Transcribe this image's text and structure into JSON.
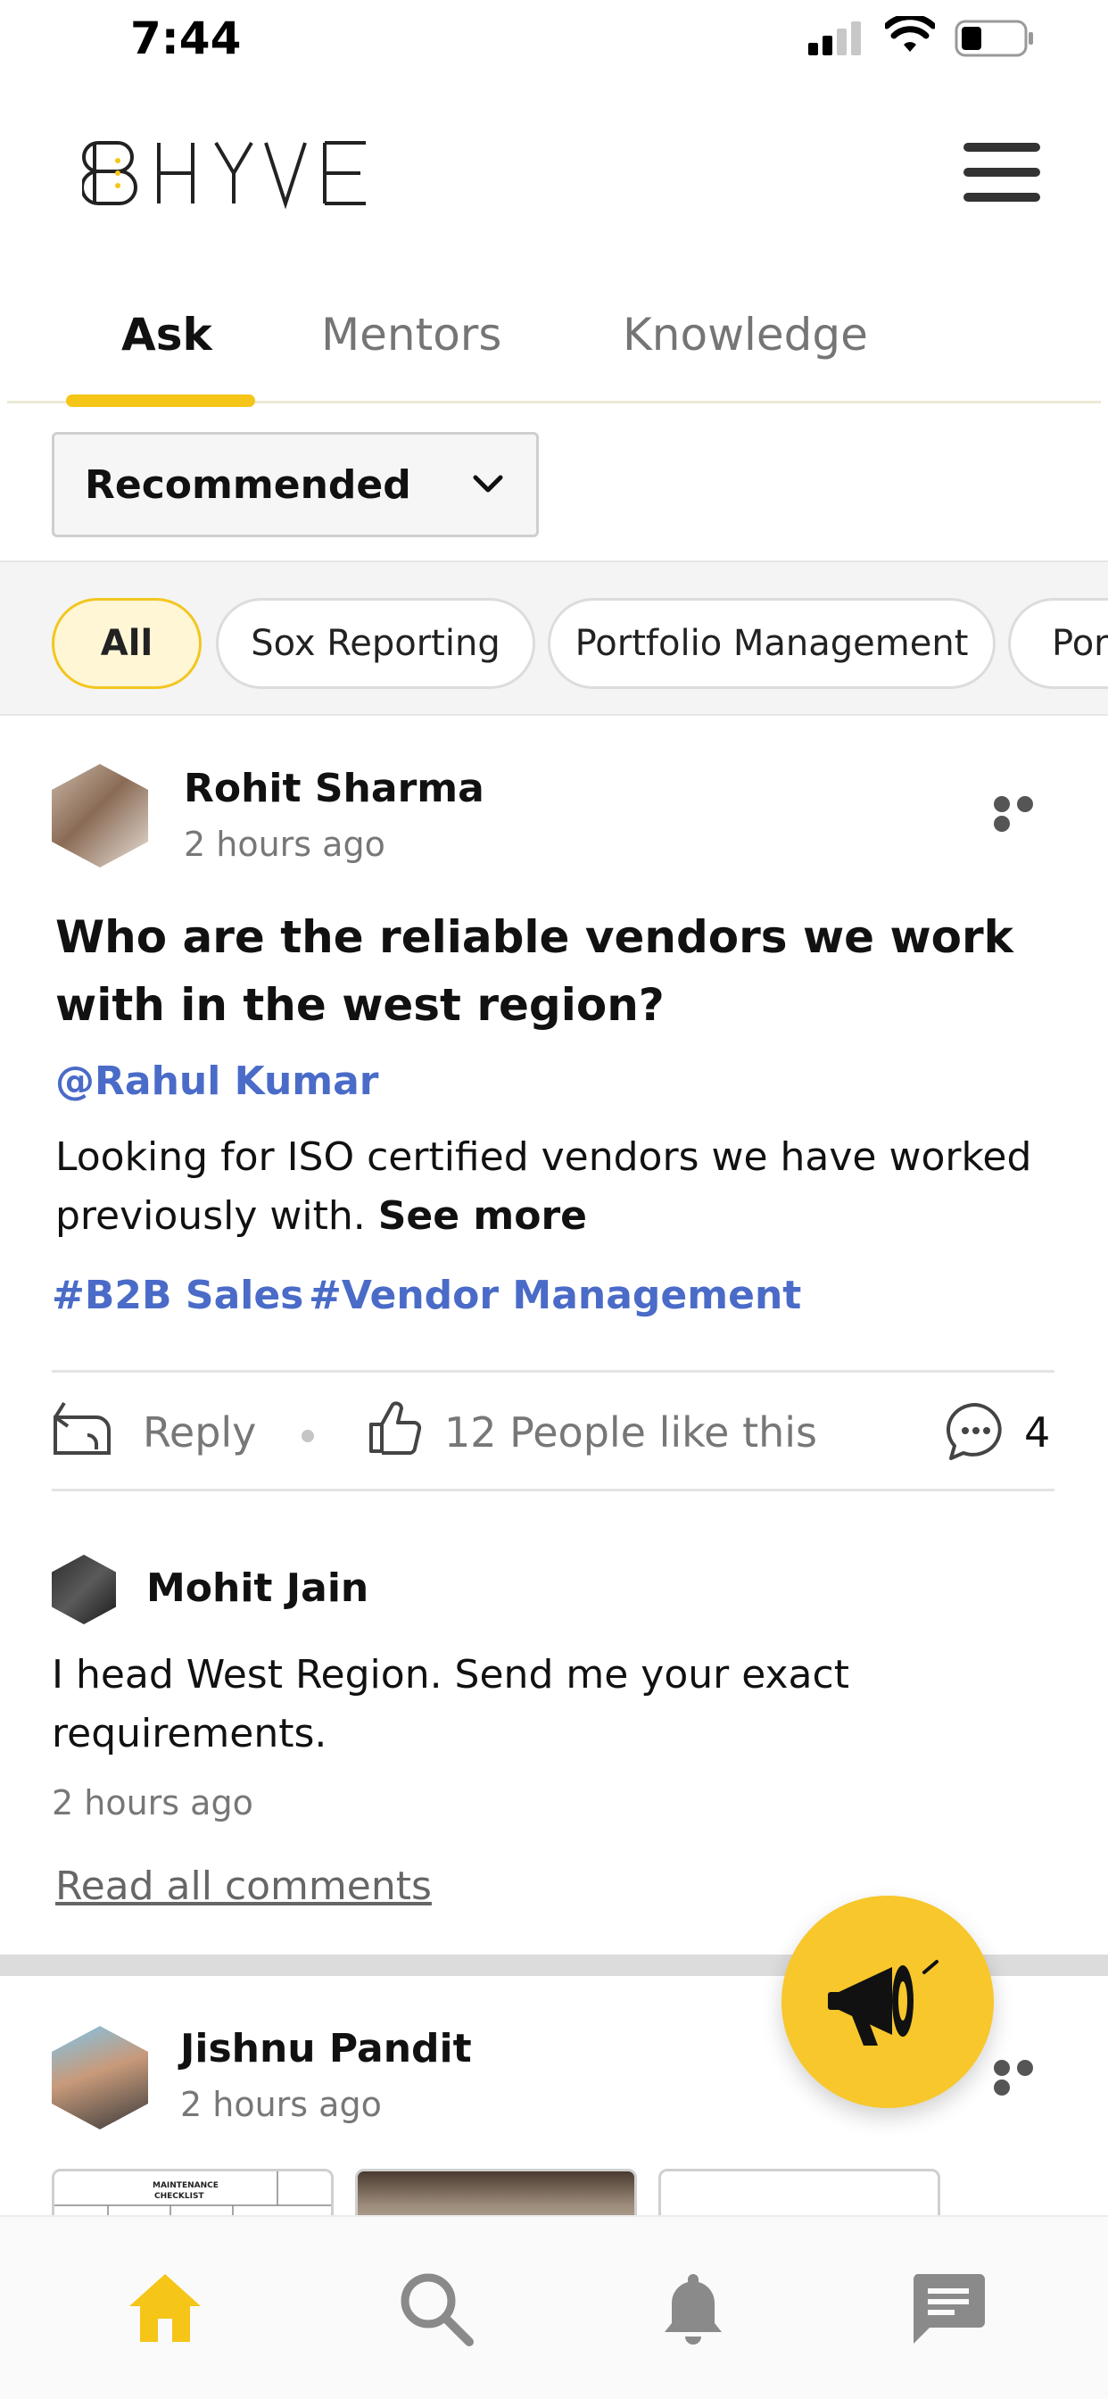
{
  "status_bar": {
    "time": "7:44"
  },
  "header": {
    "logo_text": "BHYVE",
    "menu_icon": "hamburger-icon"
  },
  "tabs": [
    {
      "label": "Ask",
      "active": true
    },
    {
      "label": "Mentors",
      "active": false
    },
    {
      "label": "Knowledge",
      "active": false
    }
  ],
  "sort": {
    "selected": "Recommended"
  },
  "filters": [
    {
      "label": "All",
      "active": true
    },
    {
      "label": "Sox Reporting",
      "active": false
    },
    {
      "label": "Portfolio Management",
      "active": false
    },
    {
      "label": "Port",
      "active": false
    }
  ],
  "posts": [
    {
      "author": "Rohit Sharma",
      "time": "2 hours ago",
      "title": "Who are the reliable vendors we work with in the west region?",
      "mention": "@Rahul Kumar",
      "body": "Looking for ISO certified vendors we have worked previously with.",
      "see_more": "See more",
      "hashtags": [
        "#B2B Sales",
        "#Vendor Management"
      ],
      "actions": {
        "reply": "Reply",
        "likes": "12 People like this",
        "comments": "4"
      },
      "top_comment": {
        "author": "Mohit Jain",
        "text": "I head West Region. Send me your exact requirements.",
        "time": "2 hours ago"
      },
      "read_all": "Read all comments"
    },
    {
      "author": "Jishnu Pandit",
      "time": "2 hours ago",
      "attachment_text": {
        "line1": "MAINTENANCE",
        "line2": "CHECKLIST"
      }
    }
  ],
  "colors": {
    "accent": "#f5c518",
    "link": "#4a6bc7",
    "muted": "#777777"
  },
  "bottom_nav": [
    {
      "name": "home",
      "active": true
    },
    {
      "name": "search",
      "active": false
    },
    {
      "name": "notifications",
      "active": false
    },
    {
      "name": "messages",
      "active": false
    }
  ]
}
